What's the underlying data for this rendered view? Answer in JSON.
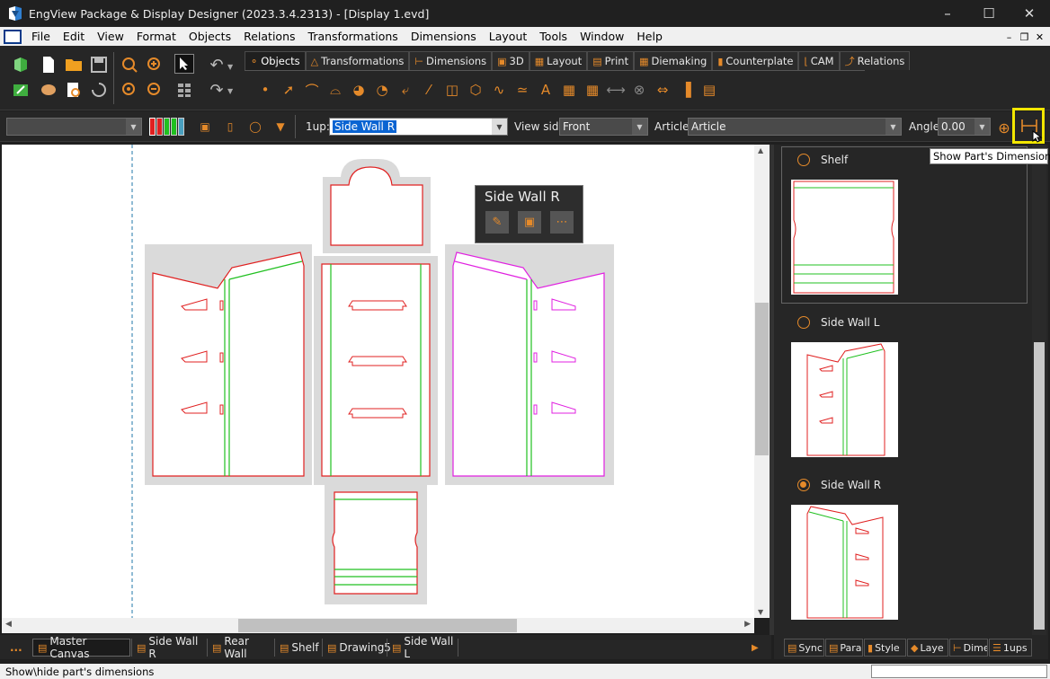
{
  "window": {
    "title": "EngView Package & Display Designer (2023.3.4.2313) - [Display 1.evd]"
  },
  "menu": [
    "File",
    "Edit",
    "View",
    "Format",
    "Objects",
    "Relations",
    "Transformations",
    "Dimensions",
    "Layout",
    "Tools",
    "Window",
    "Help"
  ],
  "ribbon_tabs": [
    {
      "label": "Objects",
      "icon": "objects-icon"
    },
    {
      "label": "Transformations",
      "icon": "transformations-icon"
    },
    {
      "label": "Dimensions",
      "icon": "dimensions-icon"
    },
    {
      "label": "3D",
      "icon": "3d-icon"
    },
    {
      "label": "Layout",
      "icon": "layout-icon"
    },
    {
      "label": "Print",
      "icon": "print-icon"
    },
    {
      "label": "Diemaking",
      "icon": "diemaking-icon"
    },
    {
      "label": "Counterplate",
      "icon": "counterplate-icon"
    },
    {
      "label": "CAM",
      "icon": "cam-icon"
    },
    {
      "label": "Relations",
      "icon": "relations-icon"
    }
  ],
  "props": {
    "oneup_label": "1up:",
    "oneup_value": "Side Wall R",
    "viewside_label": "View side",
    "viewside_value": "Front",
    "article_label": "Article:",
    "article_value": "Article",
    "angle_label": "Angle",
    "angle_value": "0.00"
  },
  "tooltip": "Show Part's Dimensions",
  "popup": {
    "title": "Side Wall R"
  },
  "bottom_tabs": [
    "...",
    "Master Canvas",
    "Side Wall R",
    "Rear Wall",
    "Shelf",
    "Drawing5",
    "Side Wall L"
  ],
  "parts": [
    {
      "name": "Shelf",
      "selected": false
    },
    {
      "name": "Side Wall L",
      "selected": false
    },
    {
      "name": "Side Wall R",
      "selected": true
    }
  ],
  "right_tabs": [
    "Sync",
    "Para",
    "Style",
    "Laye",
    "Dime",
    "1ups"
  ],
  "status": "Show\\hide part's dimensions"
}
